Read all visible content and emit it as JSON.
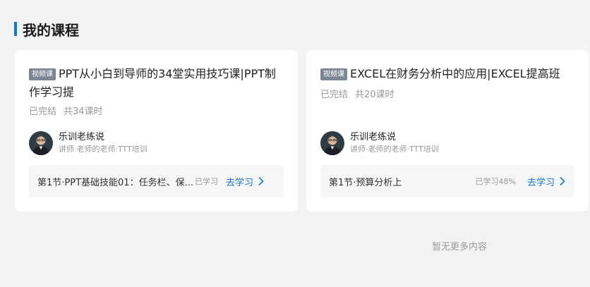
{
  "section": {
    "title": "我的课程"
  },
  "courses": [
    {
      "badge": "视频课",
      "title": "PPT从小白到导师的34堂实用技巧课|PPT制作学习提",
      "status": "已完结",
      "lessons": "共34课时",
      "teacher_name": "乐训老练说",
      "teacher_desc": "讲师·老师的老师·TTT培训",
      "current_lesson": "第1节·PPT基础技能01：任务栏、保...",
      "progress": "已学习",
      "action": "去学习"
    },
    {
      "badge": "视频课",
      "title": "EXCEL在财务分析中的应用|EXCEL提高班",
      "status": "已完结",
      "lessons": "共20课时",
      "teacher_name": "乐训老练说",
      "teacher_desc": "讲师·老师的老师·TTT培训",
      "current_lesson": "第1节·预算分析上",
      "progress": "已学习48%",
      "action": "去学习"
    }
  ],
  "footer": {
    "no_more": "暂无更多内容"
  },
  "colors": {
    "accent": "#1677d2",
    "badge": "#7b8794"
  },
  "icons": {
    "avatar": "teacher-avatar",
    "action_arrow": "chevron-right-icon"
  }
}
